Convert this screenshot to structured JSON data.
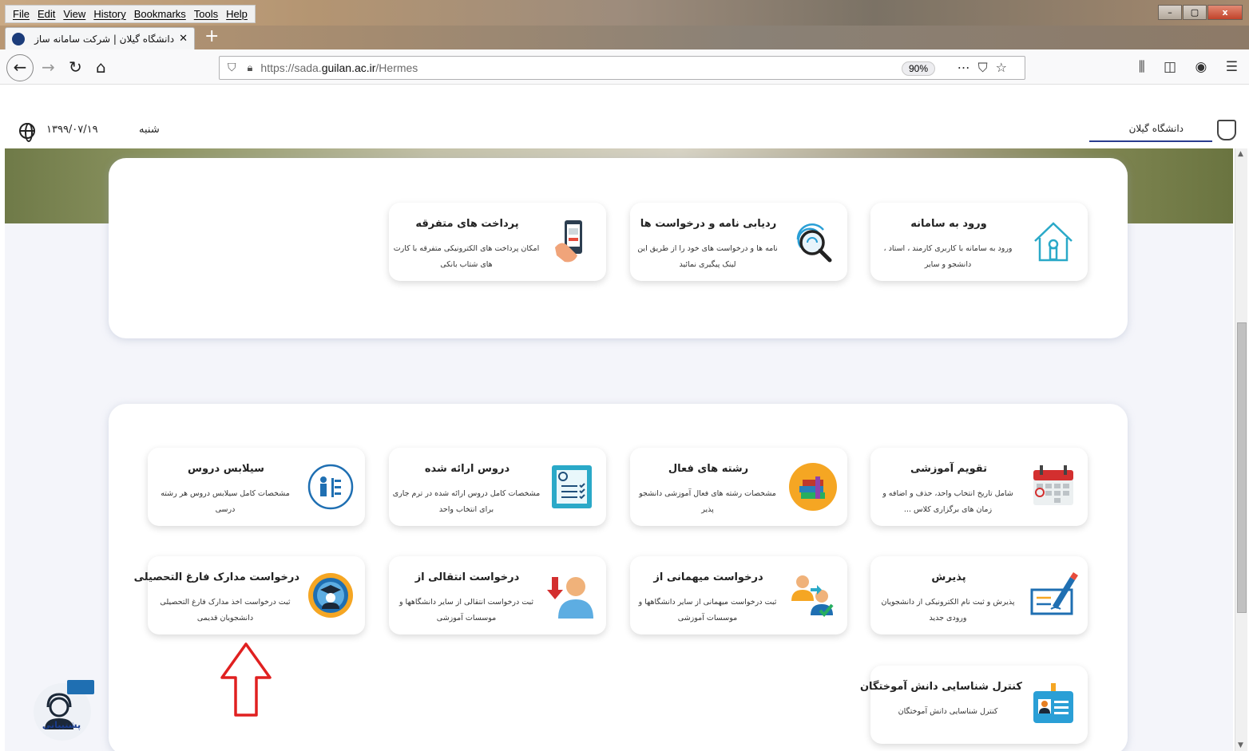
{
  "browser": {
    "menu": [
      "File",
      "Edit",
      "View",
      "History",
      "Bookmarks",
      "Tools",
      "Help"
    ],
    "tab_title": "دانشگاه گیلان | شرکت سامانه ساز",
    "tab_close": "✕",
    "new_tab": "+",
    "url_prefix": "https://sada.",
    "url_domain": "guilan.ac.ir",
    "url_path": "/Hermes",
    "zoom": "90%",
    "window_controls": [
      "–",
      "▢",
      "x"
    ]
  },
  "site": {
    "date": "۱۳۹۹/۰۷/۱۹",
    "weekday": "شنبه",
    "university": "دانشگاه گیلان",
    "support_label": "پشتیبانی"
  },
  "top_cards": [
    {
      "title": "ورود به سامانه",
      "desc": "ورود به سامانه با کاربری کارمند ، استاد ، دانشجو و سایر",
      "icon": "house-key-icon"
    },
    {
      "title": "ردیابی نامه و درخواست ها",
      "desc": "نامه ها و درخواست های خود را از طریق این لینک پیگیری نمائید",
      "icon": "fingerprint-search-icon"
    },
    {
      "title": "پرداخت های متفرقه",
      "desc": "امکان پرداخت های الکترونیکی متفرقه با کارت های شتاب بانکی",
      "icon": "mobile-payment-icon"
    }
  ],
  "edu_cards": [
    {
      "title": "تقویم آموزشی",
      "desc": "شامل تاریخ انتخاب واحد، حذف و اضافه و زمان های برگزاری کلاس ...",
      "icon": "calendar-icon"
    },
    {
      "title": "رشته های فعال",
      "desc": "مشخصات رشته های فعال آموزشی دانشجو پذیر",
      "icon": "books-icon"
    },
    {
      "title": "دروس ارائه شده",
      "desc": "مشخصات کامل دروس ارائه شده در ترم جاری برای انتخاب واحد",
      "icon": "checklist-icon"
    },
    {
      "title": "سیلابس دروس",
      "desc": "مشخصات کامل سیلابس دروس هر رشته درسی",
      "icon": "syllabus-icon"
    },
    {
      "title": "پذیرش",
      "desc": "پذیرش و ثبت نام الکترونیکی از دانشجویان ورودی جدید",
      "icon": "signing-icon"
    },
    {
      "title": "درخواست میهمانی از",
      "desc": "ثبت درخواست میهمانی از سایر دانشگاهها و موسسات آموزشی",
      "icon": "guest-users-icon"
    },
    {
      "title": "درخواست انتقالی از",
      "desc": "ثبت درخواست انتقالی از سایر دانشگاهها و موسسات آموزشی",
      "icon": "transfer-user-icon"
    },
    {
      "title": "درخواست مدارک فارغ التحصیلی",
      "desc": "ثبت درخواست اخذ مدارک فارغ التحصیلی دانشجویان قدیمی",
      "icon": "graduate-icon"
    },
    {
      "title": "کنترل شناسایی دانش آموختگان",
      "desc": "کنترل شناسایی دانش آموختگان",
      "icon": "id-card-icon"
    }
  ]
}
